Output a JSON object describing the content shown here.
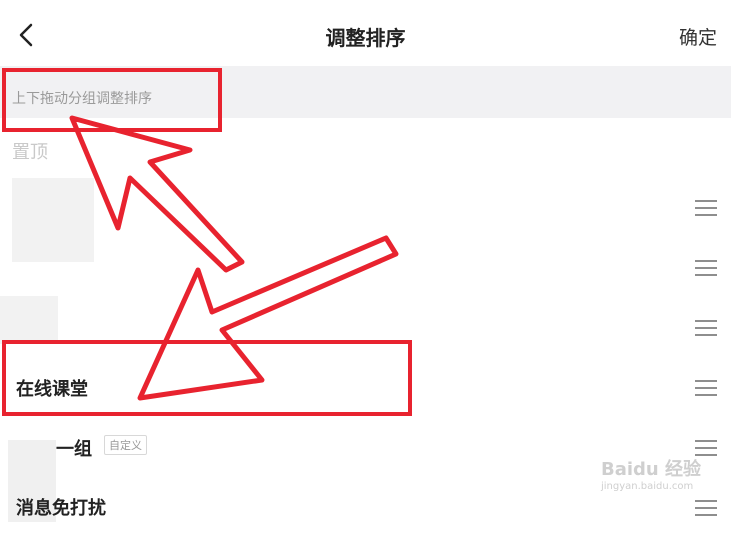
{
  "header": {
    "title": "调整排序",
    "confirm_label": "确定"
  },
  "hint_text": "上下拖动分组调整排序",
  "section_label": "置顶",
  "rows": [
    {
      "label": ""
    },
    {
      "label": ""
    },
    {
      "label": ""
    },
    {
      "label": "在线课堂"
    },
    {
      "label": "一组",
      "tag": "自定义"
    },
    {
      "label": "消息免打扰"
    }
  ],
  "watermark": {
    "brand": "Baidu 经验",
    "url": "jingyan.baidu.com"
  },
  "colors": {
    "annotation_red": "#e8232f",
    "hint_bg": "#f1f1f3"
  }
}
